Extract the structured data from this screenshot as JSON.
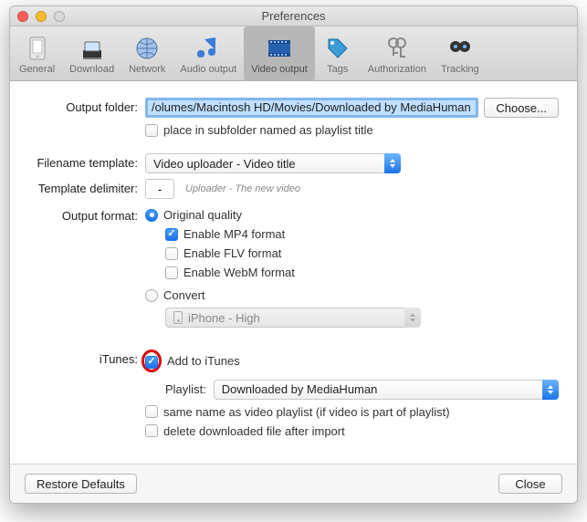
{
  "window": {
    "title": "Preferences"
  },
  "toolbar": [
    {
      "label": "General",
      "selected": false
    },
    {
      "label": "Download",
      "selected": false
    },
    {
      "label": "Network",
      "selected": false
    },
    {
      "label": "Audio output",
      "selected": false
    },
    {
      "label": "Video output",
      "selected": true
    },
    {
      "label": "Tags",
      "selected": false
    },
    {
      "label": "Authorization",
      "selected": false
    },
    {
      "label": "Tracking",
      "selected": false
    }
  ],
  "output_folder": {
    "label": "Output folder:",
    "value": "/olumes/Macintosh HD/Movies/Downloaded by MediaHuman",
    "choose_label": "Choose...",
    "place_subfolder": {
      "checked": false,
      "label": "place in subfolder named as playlist title"
    }
  },
  "filename_template": {
    "label": "Filename template:",
    "value": "Video uploader - Video title"
  },
  "template_delimiter": {
    "label": "Template delimiter:",
    "value": "-",
    "hint": "Uploader - The new video"
  },
  "output_format": {
    "label": "Output format:",
    "original": {
      "selected": true,
      "label": "Original quality"
    },
    "enable_mp4": {
      "checked": true,
      "label": "Enable MP4 format"
    },
    "enable_flv": {
      "checked": false,
      "label": "Enable FLV format"
    },
    "enable_webm": {
      "checked": false,
      "label": "Enable WebM format"
    },
    "convert": {
      "selected": false,
      "label": "Convert",
      "preset": "iPhone - High"
    }
  },
  "itunes": {
    "label": "iTunes:",
    "add": {
      "checked": true,
      "label": "Add to iTunes"
    },
    "playlist_label": "Playlist:",
    "playlist_value": "Downloaded by MediaHuman",
    "same_name": {
      "checked": false,
      "label": "same name as video playlist (if video is part of playlist)"
    },
    "delete": {
      "checked": false,
      "label": "delete downloaded file after import"
    }
  },
  "footer": {
    "restore": "Restore Defaults",
    "close": "Close"
  }
}
